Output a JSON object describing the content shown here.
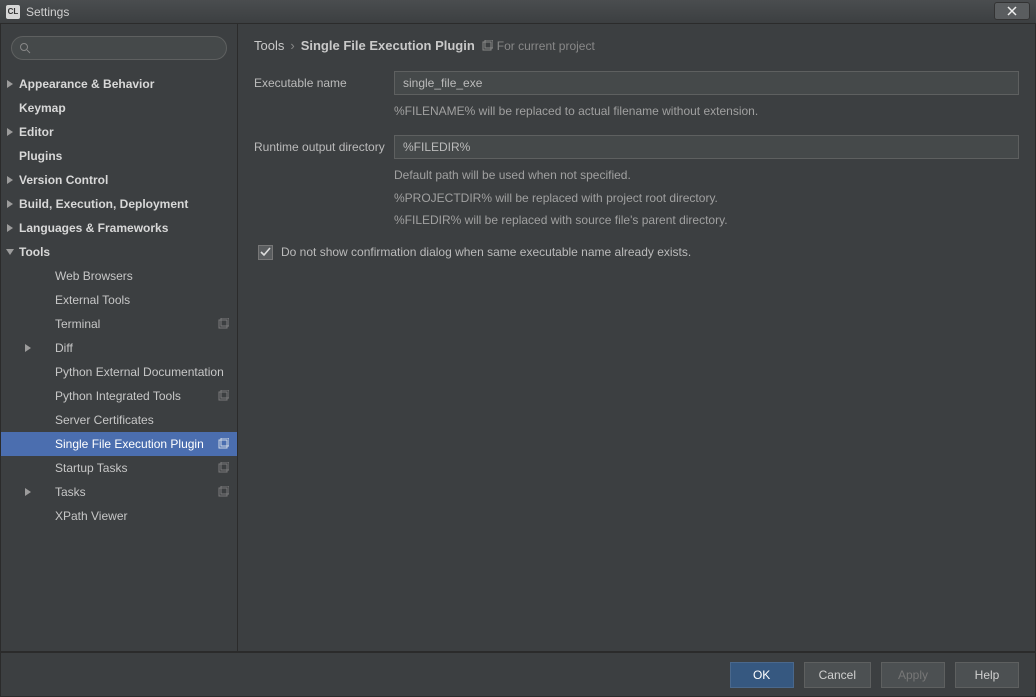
{
  "window": {
    "title": "Settings"
  },
  "search": {
    "placeholder": ""
  },
  "sidebar": {
    "items": [
      {
        "label": "Appearance & Behavior"
      },
      {
        "label": "Keymap"
      },
      {
        "label": "Editor"
      },
      {
        "label": "Plugins"
      },
      {
        "label": "Version Control"
      },
      {
        "label": "Build, Execution, Deployment"
      },
      {
        "label": "Languages & Frameworks"
      },
      {
        "label": "Tools"
      },
      {
        "label": "Web Browsers"
      },
      {
        "label": "External Tools"
      },
      {
        "label": "Terminal"
      },
      {
        "label": "Diff"
      },
      {
        "label": "Python External Documentation"
      },
      {
        "label": "Python Integrated Tools"
      },
      {
        "label": "Server Certificates"
      },
      {
        "label": "Single File Execution Plugin"
      },
      {
        "label": "Startup Tasks"
      },
      {
        "label": "Tasks"
      },
      {
        "label": "XPath Viewer"
      }
    ]
  },
  "breadcrumb": {
    "root": "Tools",
    "current": "Single File Execution Plugin",
    "suffix": "For current project"
  },
  "form": {
    "exec_label": "Executable name",
    "exec_value": "single_file_exe",
    "exec_hint": "%FILENAME% will be replaced to actual filename without extension.",
    "runtime_label": "Runtime output directory",
    "runtime_value": "%FILEDIR%",
    "runtime_hint1": "Default path will be used when not specified.",
    "runtime_hint2": "%PROJECTDIR% will be replaced with project root directory.",
    "runtime_hint3": "%FILEDIR% will be replaced with source file's parent directory.",
    "checkbox_label": "Do not show confirmation dialog when same executable name already exists."
  },
  "footer": {
    "ok": "OK",
    "cancel": "Cancel",
    "apply": "Apply",
    "help": "Help"
  }
}
